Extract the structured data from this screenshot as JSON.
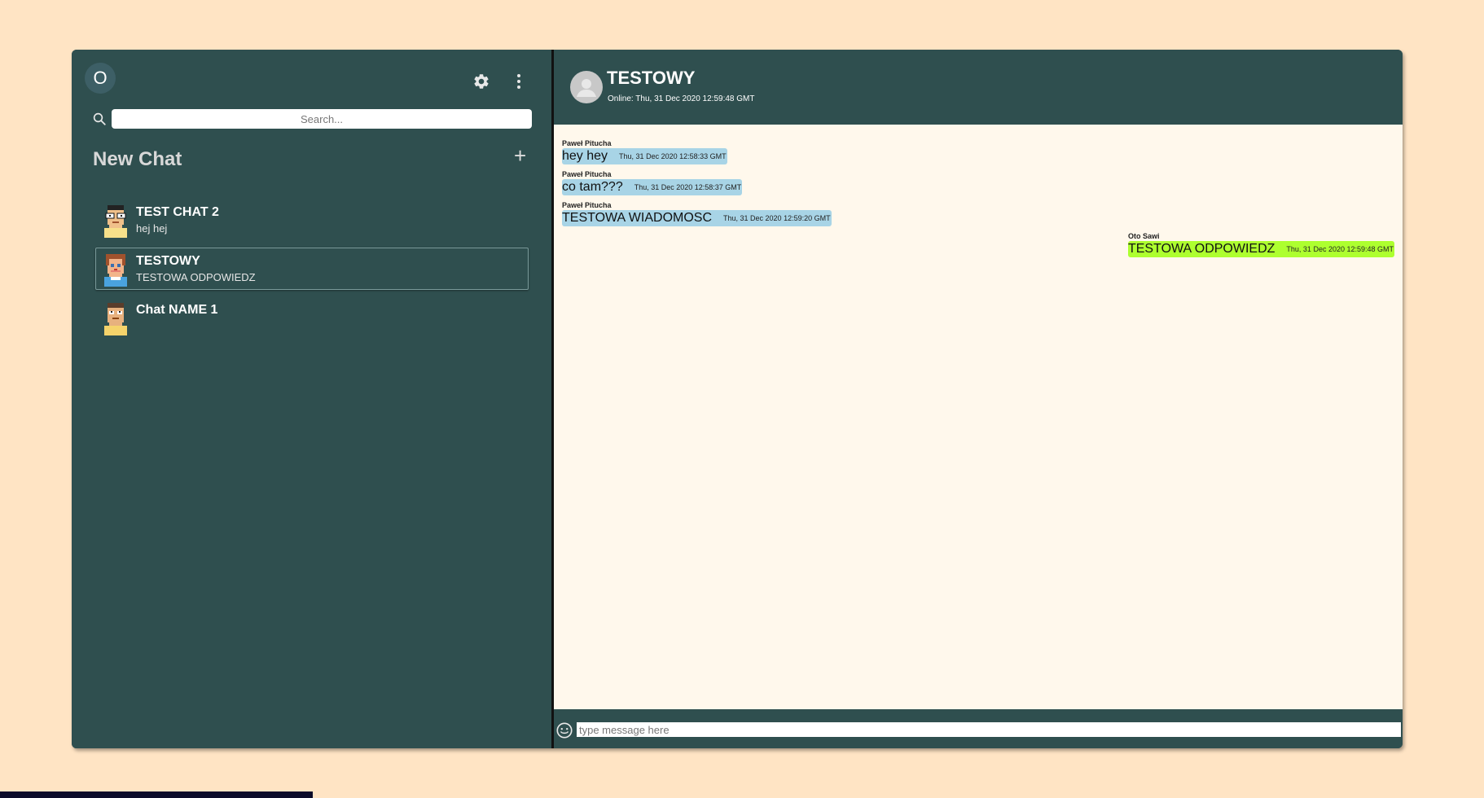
{
  "sidebar": {
    "user_initial": "O",
    "search_placeholder": "Search...",
    "new_chat_title": "New Chat",
    "add_icon": "+",
    "chats": [
      {
        "name": "TEST CHAT 2",
        "last": "hej hej",
        "active": false
      },
      {
        "name": "TESTOWY",
        "last": "TESTOWA ODPOWIEDZ",
        "active": true
      },
      {
        "name": "Chat NAME 1",
        "last": "",
        "active": false
      }
    ]
  },
  "header": {
    "title": "TESTOWY",
    "status": "Online: Thu, 31 Dec 2020 12:59:48 GMT"
  },
  "messages": [
    {
      "author": "Paweł Pitucha",
      "text": "hey hey",
      "time": "Thu, 31 Dec 2020 12:58:33 GMT",
      "own": false
    },
    {
      "author": "Paweł Pitucha",
      "text": "co tam???",
      "time": "Thu, 31 Dec 2020 12:58:37 GMT",
      "own": false
    },
    {
      "author": "Paweł Pitucha",
      "text": "TESTOWA WIADOMOSC",
      "time": "Thu, 31 Dec 2020 12:59:20 GMT",
      "own": false
    },
    {
      "author": "Oto Sawi",
      "text": "TESTOWA ODPOWIEDZ",
      "time": "Thu, 31 Dec 2020 12:59:48 GMT",
      "own": true
    }
  ],
  "composer": {
    "placeholder": "type message here"
  },
  "colors": {
    "page_bg": "#ffe4c4",
    "panel": "#2f4f4f",
    "chat_bg": "#fff8ec",
    "incoming_bubble": "#a8d4e6",
    "outgoing_bubble": "#adff2f"
  },
  "icons": {
    "settings": "gear-icon",
    "more": "more-vertical-icon",
    "search": "search-icon",
    "add": "plus-icon",
    "emoji": "emoji-icon",
    "send": "send-icon"
  }
}
